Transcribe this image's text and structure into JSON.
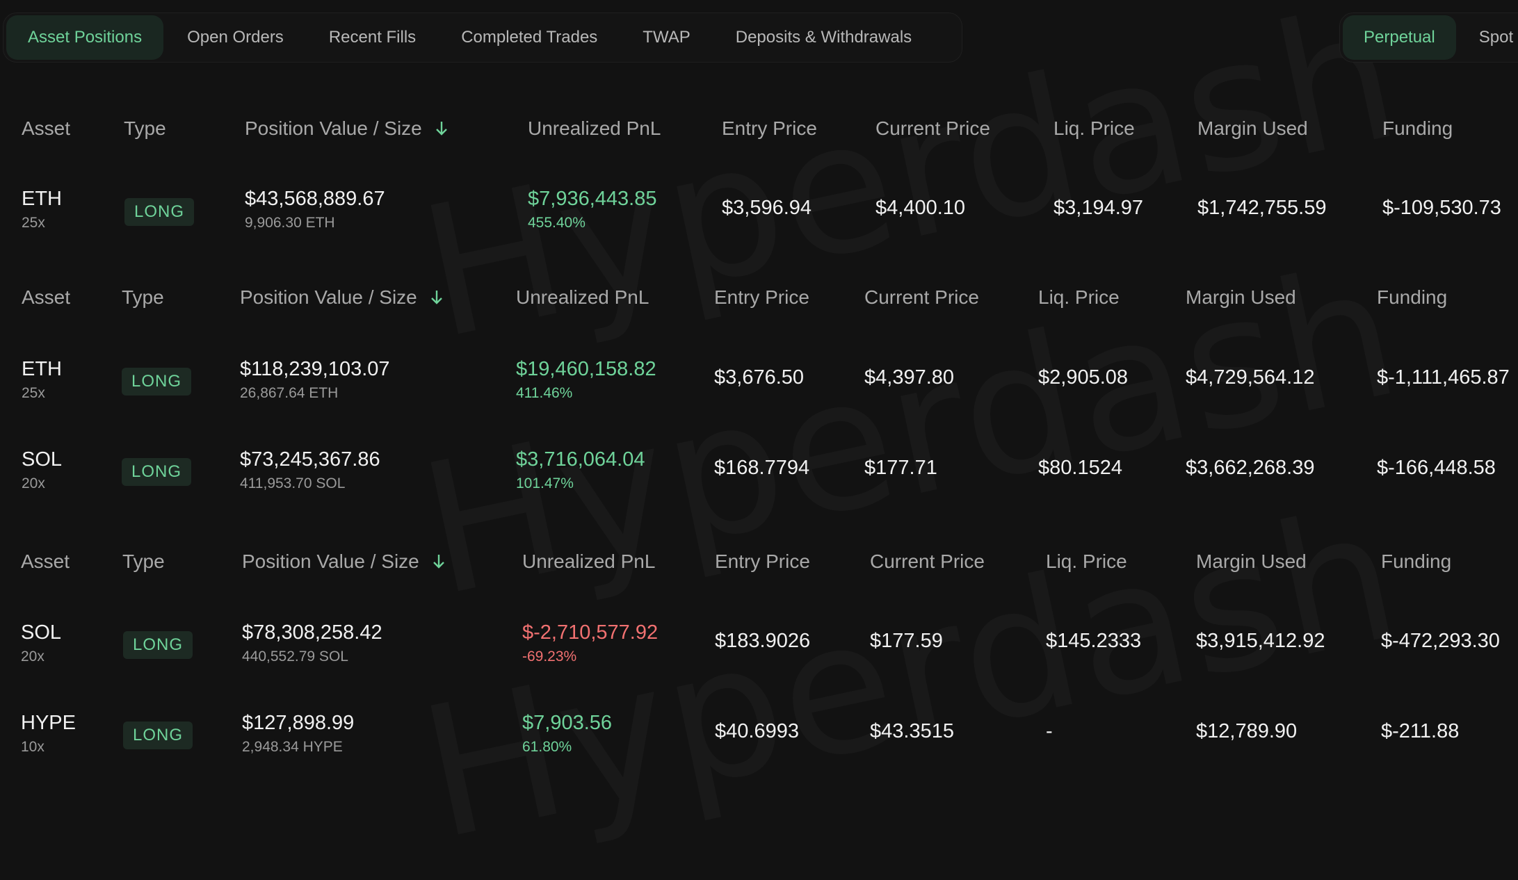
{
  "tabs": [
    "Asset Positions",
    "Open Orders",
    "Recent Fills",
    "Completed Trades",
    "TWAP",
    "Deposits & Withdrawals"
  ],
  "market_tabs": [
    "Perpetual",
    "Spot"
  ],
  "watermark": "Hyperdash",
  "headers": {
    "asset": "Asset",
    "type": "Type",
    "position_value": "Position Value / Size",
    "pnl": "Unrealized PnL",
    "entry": "Entry Price",
    "current": "Current Price",
    "liq": "Liq. Price",
    "margin": "Margin Used",
    "funding": "Funding"
  },
  "tables": [
    {
      "rows": [
        {
          "asset": "ETH",
          "leverage": "25x",
          "type": "LONG",
          "value": "$43,568,889.67",
          "size": "9,906.30 ETH",
          "pnl": "$7,936,443.85",
          "pnl_pct": "455.40%",
          "entry": "$3,596.94",
          "current": "$4,400.10",
          "liq": "$3,194.97",
          "margin": "$1,742,755.59",
          "funding": "$-109,530.73"
        }
      ]
    },
    {
      "rows": [
        {
          "asset": "ETH",
          "leverage": "25x",
          "type": "LONG",
          "value": "$118,239,103.07",
          "size": "26,867.64 ETH",
          "pnl": "$19,460,158.82",
          "pnl_pct": "411.46%",
          "entry": "$3,676.50",
          "current": "$4,397.80",
          "liq": "$2,905.08",
          "margin": "$4,729,564.12",
          "funding": "$-1,111,465.87"
        },
        {
          "asset": "SOL",
          "leverage": "20x",
          "type": "LONG",
          "value": "$73,245,367.86",
          "size": "411,953.70 SOL",
          "pnl": "$3,716,064.04",
          "pnl_pct": "101.47%",
          "entry": "$168.7794",
          "current": "$177.71",
          "liq": "$80.1524",
          "margin": "$3,662,268.39",
          "funding": "$-166,448.58"
        }
      ]
    },
    {
      "rows": [
        {
          "asset": "SOL",
          "leverage": "20x",
          "type": "LONG",
          "value": "$78,308,258.42",
          "size": "440,552.79 SOL",
          "pnl": "$-2,710,577.92",
          "pnl_pct": "-69.23%",
          "entry": "$183.9026",
          "current": "$177.59",
          "liq": "$145.2333",
          "margin": "$3,915,412.92",
          "funding": "$-472,293.30"
        },
        {
          "asset": "HYPE",
          "leverage": "10x",
          "type": "LONG",
          "value": "$127,898.99",
          "size": "2,948.34 HYPE",
          "pnl": "$7,903.56",
          "pnl_pct": "61.80%",
          "entry": "$40.6993",
          "current": "$43.3515",
          "liq": "-",
          "margin": "$12,789.90",
          "funding": "$-211.88"
        }
      ]
    }
  ],
  "colors": {
    "green": "#6fd39a",
    "red": "#f17171",
    "background": "#121212"
  }
}
